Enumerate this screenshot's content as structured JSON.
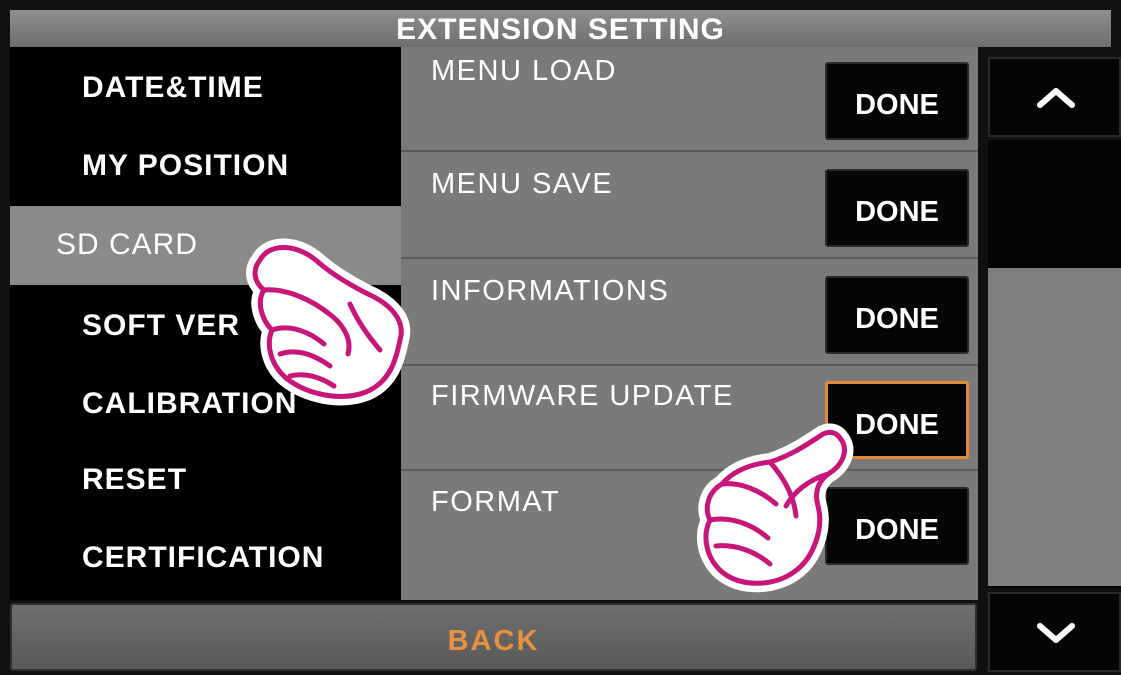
{
  "header": {
    "title": "EXTENSION SETTING"
  },
  "sidebar": {
    "items": [
      {
        "label": "DATE&TIME"
      },
      {
        "label": "MY POSITION"
      },
      {
        "label": "SD CARD"
      },
      {
        "label": "SOFT VER"
      },
      {
        "label": "CALIBRATION"
      },
      {
        "label": "RESET"
      },
      {
        "label": "CERTIFICATION"
      }
    ],
    "selected": "SD CARD"
  },
  "main": {
    "rows": [
      {
        "label": "MENU LOAD",
        "button": "DONE"
      },
      {
        "label": "MENU SAVE",
        "button": "DONE"
      },
      {
        "label": "INFORMATIONS",
        "button": "DONE"
      },
      {
        "label": "FIRMWARE UPDATE",
        "button": "DONE"
      },
      {
        "label": "FORMAT",
        "button": "DONE"
      }
    ],
    "focused_row": "FIRMWARE UPDATE"
  },
  "footer": {
    "back_label": "BACK"
  },
  "icons": {
    "scroll_up": "chevron-up-icon",
    "scroll_down": "chevron-down-icon",
    "pointer": "pointing-hand-icon"
  },
  "colors": {
    "accent": "#e8913e",
    "focus_border": "#e08a3a",
    "hand_outline": "#c8157a"
  }
}
